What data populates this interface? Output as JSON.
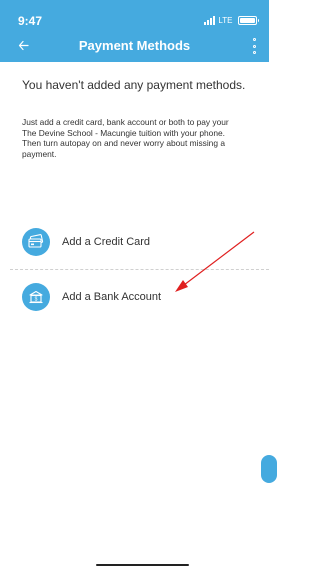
{
  "status_bar": {
    "time": "9:47",
    "network": "LTE"
  },
  "header": {
    "title": "Payment Methods",
    "back_icon": "back-arrow-icon",
    "menu_icon": "vertical-dots-icon"
  },
  "main": {
    "empty_message": "You haven't added any payment methods.",
    "info_lines": [
      "Just add a credit card, bank account or both to pay your",
      "The Devine School - Macungie tuition with your phone.",
      "Then turn autopay on and never worry about missing a",
      "payment."
    ]
  },
  "options": [
    {
      "label": "Add a Credit Card",
      "icon": "credit-card-icon"
    },
    {
      "label": "Add a Bank Account",
      "icon": "bank-icon"
    }
  ],
  "colors": {
    "accent": "#45aadf",
    "annotation": "#e02020"
  }
}
